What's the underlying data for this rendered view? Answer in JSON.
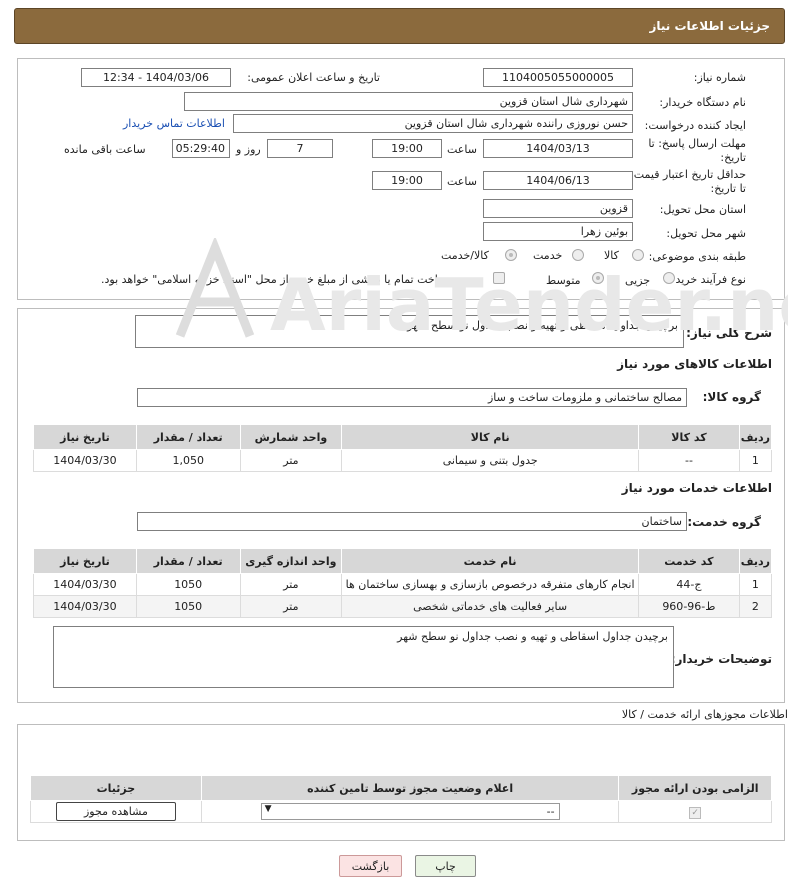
{
  "header": {
    "title": "جزئیات اطلاعات نیاز"
  },
  "form": {
    "need_number_label": "شماره نیاز:",
    "need_number": "1104005055000005",
    "announce_label": "تاریخ و ساعت اعلان عمومی:",
    "announce_value": "1404/03/06 - 12:34",
    "buyer_org_label": "نام دستگاه خریدار:",
    "buyer_org": "شهرداری شال استان قزوین",
    "creator_label": "ایجاد کننده درخواست:",
    "creator": "حسن نوروزی راننده شهرداری شال استان قزوین",
    "contact_link": "اطلاعات تماس خریدار",
    "deadline_label_1": "مهلت ارسال پاسخ: تا",
    "deadline_label_2": "تاریخ:",
    "deadline_date": "1404/03/13",
    "time_label": "ساعت",
    "deadline_time": "19:00",
    "days_value": "7",
    "days_label": "روز و",
    "remaining_time": "05:29:40",
    "remaining_label": "ساعت باقی مانده",
    "validity_label_1": "حداقل تاریخ اعتبار قیمت:",
    "validity_label_2": "تا تاریخ:",
    "validity_date": "1404/06/13",
    "validity_time": "19:00",
    "province_label": "استان محل تحویل:",
    "province": "قزوین",
    "city_label": "شهر محل تحویل:",
    "city": "بوئین زهرا",
    "category_label": "طبقه بندی موضوعی:",
    "category_options": [
      "کالا",
      "خدمت",
      "کالا/خدمت"
    ],
    "process_label": "نوع فرآیند خرید :",
    "process_options": [
      "جزیی",
      "متوسط"
    ],
    "payment_note": "پرداخت تمام یا بخشی از مبلغ خرید،از محل \"اسناد خزانه اسلامی\" خواهد بود."
  },
  "summary": {
    "label": "شرح کلی نیاز:",
    "text": "برچیدن جداول اسقاطی و تهیه و نصب جداول نو سطح شهر"
  },
  "goods": {
    "section_title": "اطلاعات کالاهای مورد نیاز",
    "group_label": "گروه کالا:",
    "group_value": "مصالح ساختمانی و ملزومات ساخت و ساز",
    "columns": [
      "ردیف",
      "کد کالا",
      "نام کالا",
      "واحد شمارش",
      "تعداد / مقدار",
      "تاریخ نیاز"
    ],
    "rows": [
      [
        "1",
        "--",
        "جدول بتنی و سیمانی",
        "متر",
        "1,050",
        "1404/03/30"
      ]
    ]
  },
  "services": {
    "section_title": "اطلاعات خدمات مورد نیاز",
    "group_label": "گروه خدمت:",
    "group_value": "ساختمان",
    "columns": [
      "ردیف",
      "کد خدمت",
      "نام خدمت",
      "واحد اندازه گیری",
      "تعداد / مقدار",
      "تاریخ نیاز"
    ],
    "rows": [
      [
        "1",
        "ج-44",
        "انجام کارهای متفرقه درخصوص بازسازی و بهسازی ساختمان ها",
        "متر",
        "1050",
        "1404/03/30"
      ],
      [
        "2",
        "ط-96-960",
        "سایر فعالیت های خدماتی شخصی",
        "متر",
        "1050",
        "1404/03/30"
      ]
    ]
  },
  "buyer_notes": {
    "label": "توضیحات خریدار:",
    "text": "برچیدن جداول اسقاطی و تهیه و نصب جداول نو سطح شهر"
  },
  "licenses": {
    "title": "اطلاعات مجوزهای ارائه خدمت / کالا",
    "columns": [
      "الزامی بودن ارائه مجوز",
      "اعلام وضعیت مجوز توسط تامین کننده",
      "جزئیات"
    ],
    "select_value": "--",
    "view_button": "مشاهده مجوز"
  },
  "footer": {
    "print_button": "چاپ",
    "back_button": "بازگشت"
  },
  "watermark": {
    "text": "AriaTender.net"
  },
  "colors": {
    "header_bg": "#8b6a3d",
    "link": "#1a4fb3",
    "back_button_bg": "#fbe3e3",
    "print_button_bg": "#eaf5e4"
  }
}
